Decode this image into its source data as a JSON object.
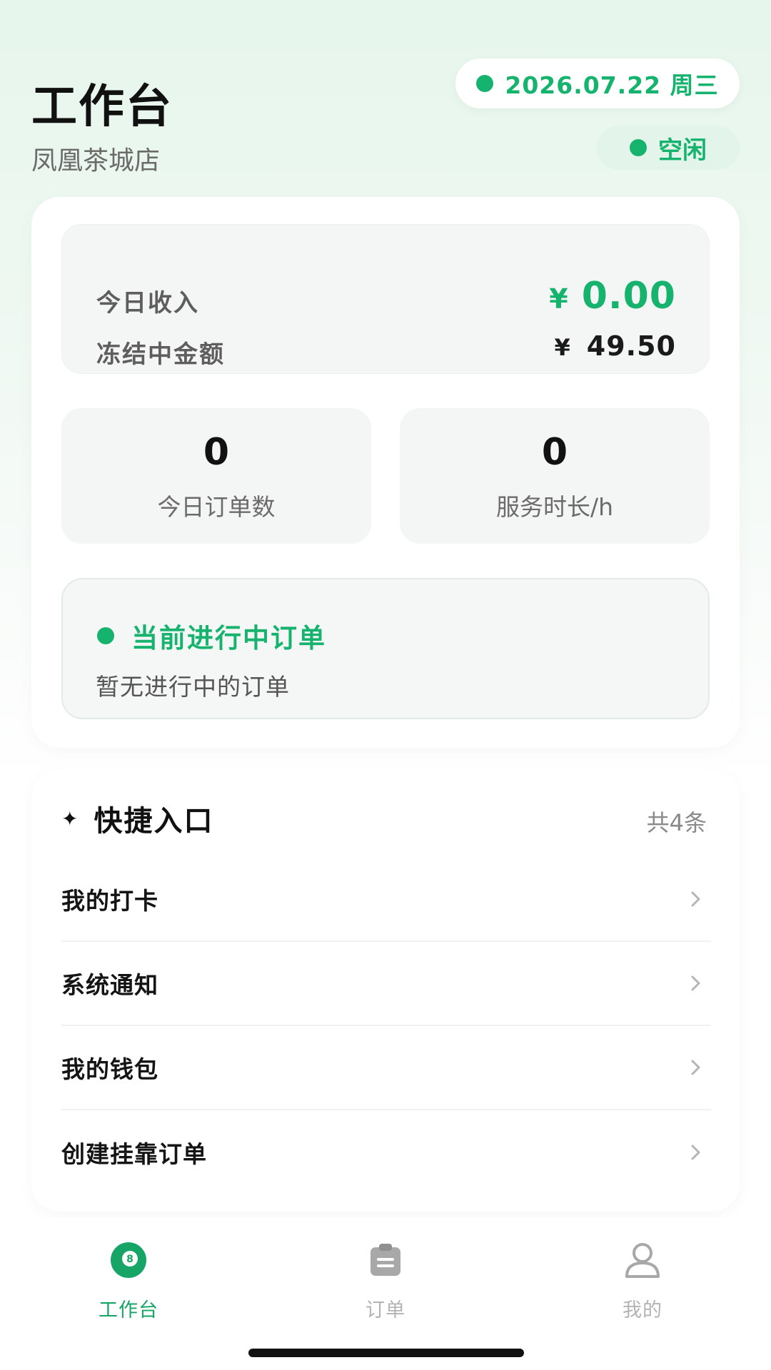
{
  "header": {
    "title": "工作台",
    "store_name": "凤凰茶城店",
    "date": "2026.07.22 周三",
    "status": "空闲"
  },
  "income": {
    "today_label": "今日收入",
    "today_currency": "¥",
    "today_value": "0.00",
    "frozen_label": "冻结中金额",
    "frozen_currency": "¥",
    "frozen_value": "49.50"
  },
  "stats": [
    {
      "value": "0",
      "label": "今日订单数"
    },
    {
      "value": "0",
      "label": "服务时长/h"
    }
  ],
  "current_order": {
    "title": "当前进行中订单",
    "empty_text": "暂无进行中的订单"
  },
  "quick": {
    "title": "快捷入口",
    "count": "共4条",
    "items": [
      {
        "label": "我的打卡"
      },
      {
        "label": "系统通知"
      },
      {
        "label": "我的钱包"
      },
      {
        "label": "创建挂靠订单"
      }
    ]
  },
  "tabbar": {
    "items": [
      {
        "label": "工作台",
        "icon": "billiard-ball-icon",
        "active": true
      },
      {
        "label": "订单",
        "icon": "clipboard-icon",
        "active": false
      },
      {
        "label": "我的",
        "icon": "user-icon",
        "active": false
      }
    ]
  },
  "colors": {
    "accent": "#16b36e",
    "tab_active": "#16a566",
    "tab_inactive": "#b3b3b3"
  }
}
